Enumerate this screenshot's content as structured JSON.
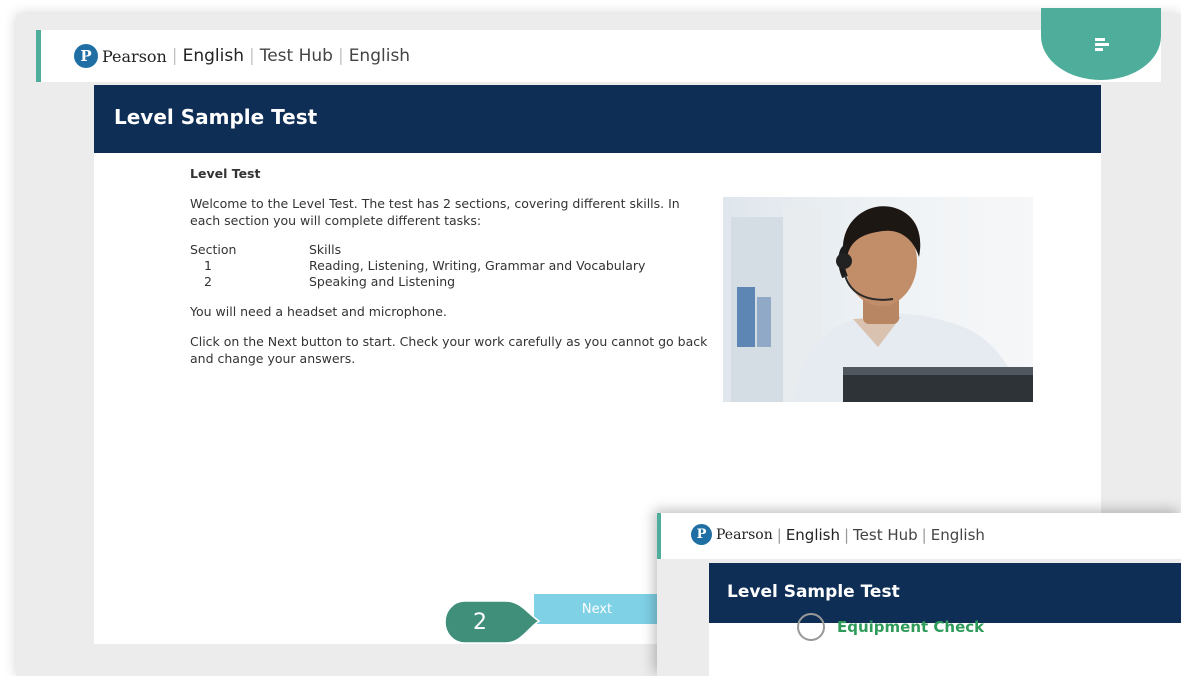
{
  "main": {
    "header": {
      "brand": {
        "logo_letter": "P",
        "name": "Pearson",
        "product": "English",
        "app": "Test Hub",
        "language": "English"
      },
      "menu_icon": "menu-icon"
    },
    "title": "Level Sample Test",
    "subtitle": "Level Test",
    "intro": "Welcome to the Level Test. The test has 2 sections, covering different skills. In each section you will complete different tasks:",
    "table": {
      "headers": [
        "Section",
        "Skills"
      ],
      "rows": [
        {
          "section": "1",
          "skills": "Reading, Listening, Writing, Grammar and Vocabulary"
        },
        {
          "section": "2",
          "skills": "Speaking and Listening"
        }
      ]
    },
    "equipment_note": "You will need a headset and microphone.",
    "instructions": "Click on the Next button to start. Check your work carefully as you cannot go back and change your answers.",
    "next_label": "Next",
    "step_number": "2"
  },
  "overlay": {
    "header": {
      "brand": {
        "logo_letter": "P",
        "name": "Pearson",
        "product": "English",
        "app": "Test Hub",
        "language": "English"
      }
    },
    "title": "Level Sample Test",
    "equipment_check": "Equipment Check"
  },
  "colors": {
    "navy": "#0e2e55",
    "teal": "#4fae9b",
    "next_button": "#7fd1e6",
    "step_bubble": "#3f8f7b",
    "logo_blue": "#1f6fa5",
    "equipment_green": "#2f9b5a"
  }
}
